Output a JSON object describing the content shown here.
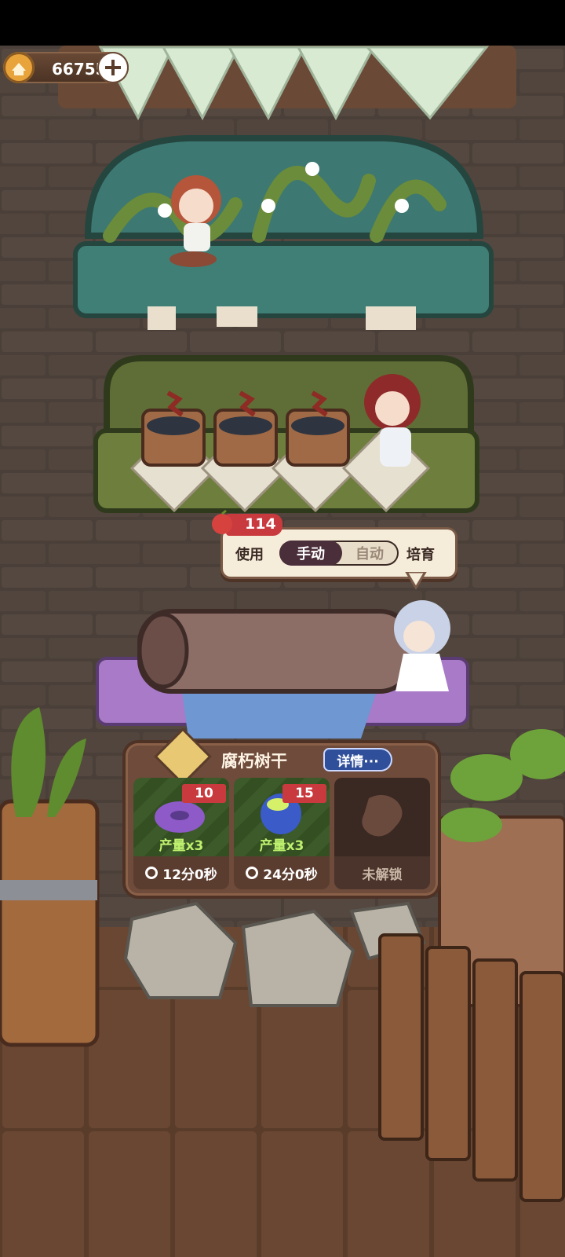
{
  "currency": {
    "amount": "66755",
    "icon": "coin-house-icon",
    "add_icon": "plus-icon"
  },
  "usage": {
    "fruit_count": "114",
    "use_label": "使用",
    "manual_label": "手动",
    "auto_label": "自动",
    "nurture_label": "培育",
    "selected": "手动"
  },
  "panel": {
    "title": "腐朽树干",
    "detail_label": "详情···",
    "options": [
      {
        "cost": "10",
        "yield": "产量x3",
        "time": "12分0秒",
        "locked": false,
        "icon": "purple-mushroom-icon"
      },
      {
        "cost": "15",
        "yield": "产量x3",
        "time": "24分0秒",
        "locked": false,
        "icon": "blue-slime-mushroom-icon"
      },
      {
        "label": "未解锁",
        "locked": true,
        "icon": "locked-silhouette-icon"
      }
    ]
  },
  "colors": {
    "accent_red": "#c93a3e",
    "panel_brown": "#6e4b3a",
    "yield_green": "#bff06e",
    "toggle_dark": "#4a2e3a"
  }
}
